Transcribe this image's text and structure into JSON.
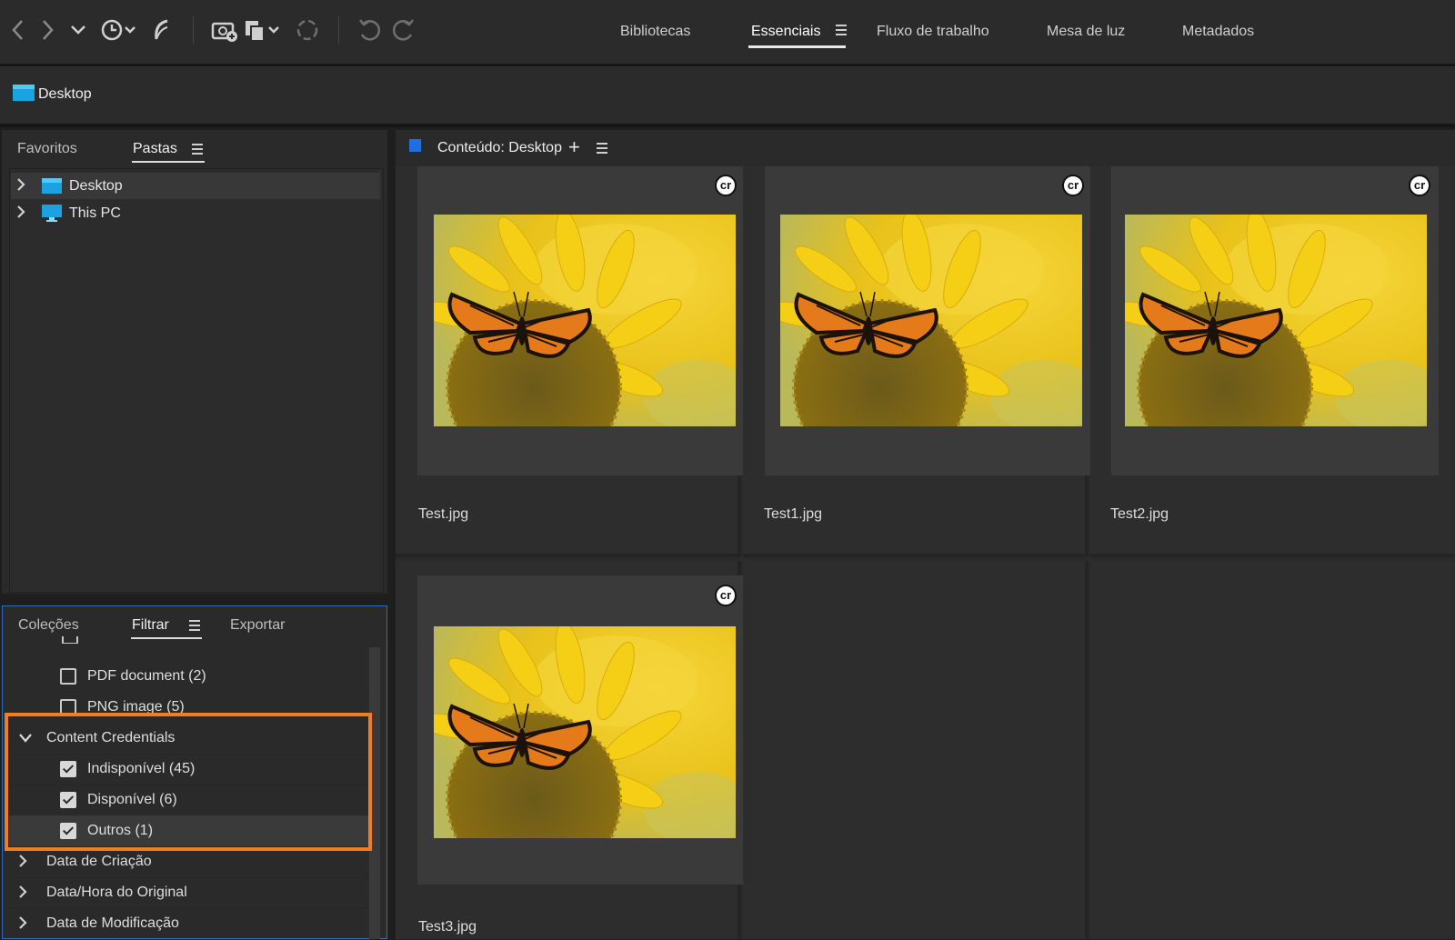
{
  "toolbar": {
    "icons": [
      "back-icon",
      "forward-icon",
      "dropdown-chevron-icon",
      "recent-history-icon",
      "boomerang-icon",
      "camera-import-icon",
      "copy-dropdown-icon",
      "refine-icon",
      "rotate-left-icon",
      "rotate-right-icon"
    ]
  },
  "workspaces": {
    "items": [
      {
        "label": "Bibliotecas"
      },
      {
        "label": "Essenciais"
      },
      {
        "label": "Fluxo de trabalho"
      },
      {
        "label": "Mesa de luz"
      },
      {
        "label": "Metadados"
      }
    ],
    "active": "Essenciais"
  },
  "path": {
    "label": "Desktop"
  },
  "folders_panel": {
    "tabs": [
      {
        "label": "Favoritos"
      },
      {
        "label": "Pastas"
      }
    ],
    "active_tab": "Pastas",
    "tree": [
      {
        "label": "Desktop",
        "selected": true
      },
      {
        "label": "This PC",
        "selected": false
      }
    ]
  },
  "filter_panel": {
    "tabs": [
      {
        "label": "Coleções"
      },
      {
        "label": "Filtrar"
      },
      {
        "label": "Exportar"
      }
    ],
    "active_tab": "Filtrar",
    "rows": [
      {
        "type": "check",
        "label": "PDF document  (2)",
        "checked": false
      },
      {
        "type": "check",
        "label": "PNG image  (5)",
        "checked": false
      },
      {
        "type": "group",
        "label": "Content Credentials",
        "expanded": true
      },
      {
        "type": "check",
        "label": "Indisponível  (45)",
        "checked": true
      },
      {
        "type": "check",
        "label": "Disponível  (6)",
        "checked": true
      },
      {
        "type": "check",
        "label": "Outros  (1)",
        "checked": true
      },
      {
        "type": "group",
        "label": "Data de Criação",
        "expanded": false
      },
      {
        "type": "group",
        "label": "Data/Hora do Original",
        "expanded": false
      },
      {
        "type": "group",
        "label": "Data de Modificação",
        "expanded": false
      }
    ],
    "highlight_color": "#f07d20"
  },
  "content": {
    "header_label": "Conteúdo: Desktop",
    "add_label": "+",
    "badge_text": "cr",
    "items": [
      {
        "name": "Test.jpg"
      },
      {
        "name": "Test1.jpg"
      },
      {
        "name": "Test2.jpg"
      },
      {
        "name": "Test3.jpg"
      }
    ]
  }
}
